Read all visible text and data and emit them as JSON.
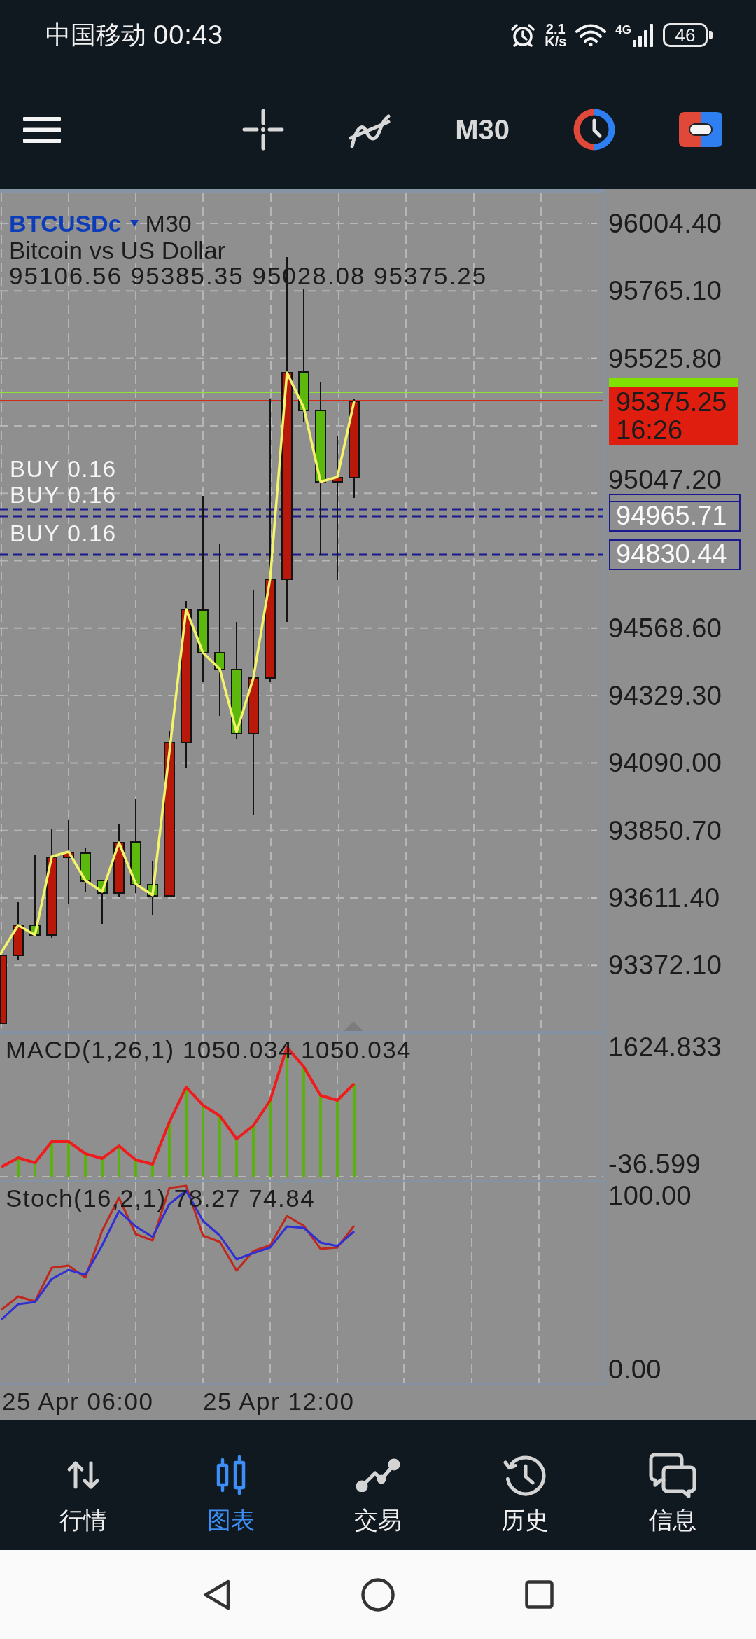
{
  "status_bar": {
    "carrier": "中国移动",
    "time": "00:43",
    "speed_value": "2.1",
    "speed_unit": "K/s",
    "network": "4G",
    "battery": "46"
  },
  "toolbar": {
    "timeframe": "M30"
  },
  "chart": {
    "symbol": "BTCUSDc",
    "period": "M30",
    "description": "Bitcoin vs US Dollar",
    "ohlc": "95106.56 95385.35 95028.08 95375.25",
    "price_scale": [
      "96004.40",
      "95765.10",
      "95525.80",
      "95047.20",
      "94568.60",
      "94329.30",
      "94090.00",
      "93850.70",
      "93611.40",
      "93372.10"
    ],
    "bid_tag": {
      "price": "95375.25",
      "countdown": "16:26"
    },
    "orders": [
      {
        "label": "BUY 0.16"
      },
      {
        "label": "BUY 0.16",
        "price": "94965.71"
      },
      {
        "label": "BUY 0.16",
        "price": "94830.44"
      }
    ]
  },
  "macd": {
    "title": "MACD(1,26,1) 1050.034 1050.034",
    "scale": [
      "1624.833",
      "-36.599"
    ]
  },
  "stochastic": {
    "title": "Stoch(16,2,1) 78.27 74.84",
    "scale": [
      "100.00",
      "0.00"
    ]
  },
  "time_axis": [
    "25 Apr 06:00",
    "25 Apr 12:00"
  ],
  "bottom_nav": [
    {
      "label": "行情",
      "selected": false
    },
    {
      "label": "图表",
      "selected": true
    },
    {
      "label": "交易",
      "selected": false
    },
    {
      "label": "历史",
      "selected": false
    },
    {
      "label": "信息",
      "selected": false
    }
  ]
}
